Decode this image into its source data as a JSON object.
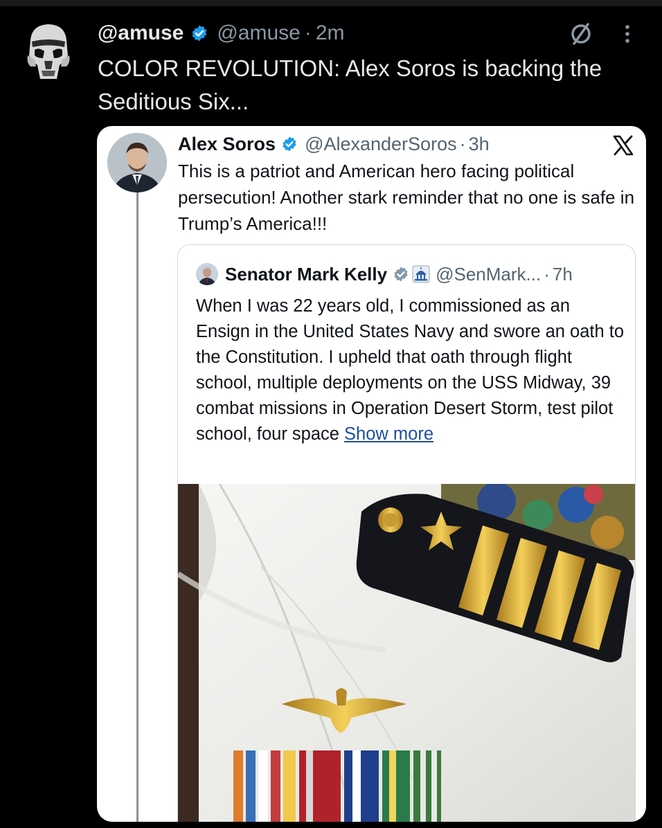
{
  "outer_post": {
    "display_name": "@amuse",
    "handle": "@amuse",
    "separator": "·",
    "time": "2m",
    "text": "COLOR REVOLUTION: Alex Soros is backing the Seditious Six...",
    "menu_icon": "more-vertical-icon",
    "mute_icon": "circle-slash-icon"
  },
  "quoted_post": {
    "display_name": "Alex Soros",
    "handle": "@AlexanderSoros",
    "separator": "·",
    "time": "3h",
    "text": "This is a patriot and American hero facing political persecution! Another stark reminder that no one is safe in Trump’s America!!!",
    "platform_icon": "x-logo-icon"
  },
  "nested_quote": {
    "display_name": "Senator Mark Kelly",
    "handle": "@SenMark...",
    "separator": "·",
    "time": "7h",
    "text": "When I was 22 years old, I commissioned as an Ensign in the United States Navy and swore an oath to the Constitution. I upheld that oath through flight school, multiple deployments on the USS Midway, 39 combat missions in Operation Desert Storm, test pilot school, four space",
    "show_more": "Show more",
    "media": "photo-uniform-with-insignia"
  },
  "colors": {
    "background": "#000000",
    "verified_blue": "#1d9bf0",
    "card_background": "#ffffff",
    "link": "#1d4fa0",
    "secondary_text_dark": "#8b98a5",
    "secondary_text_light": "#536471"
  }
}
